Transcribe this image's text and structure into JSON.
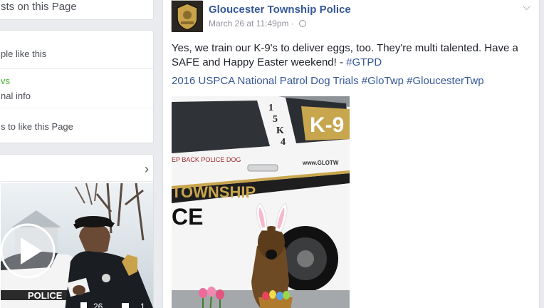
{
  "left": {
    "top_card_text": "sts on this Page",
    "about": {
      "rows": [
        {
          "label": "ple like this"
        },
        {
          "label": "vs",
          "green": true
        },
        {
          "label": "nal info"
        },
        {
          "label": "s to like this Page"
        }
      ]
    },
    "video": {
      "chevron": "›",
      "stats": [
        "26",
        "1"
      ],
      "car_text": "POLICE"
    }
  },
  "post": {
    "page_name": "Gloucester Township Police",
    "timestamp": "March 26 at 11:49pm · ",
    "text_main": "Yes, we train our K-9's to deliver eggs, too. They're multi talented. Have a SAFE and Happy Easter weekend! - ",
    "text_hashtag": "#GTPD",
    "link_line": "2016 USPCA National Patrol Dog Trials #GloTwp #GloucesterTwp",
    "photo": {
      "car_number": "15K4",
      "k9_text": "K-9",
      "small_text": "EP BACK POLICE DOG",
      "url_text": "www.GLOTW",
      "township_text": "TOWNSHIP",
      "ce_text": "CE"
    }
  }
}
